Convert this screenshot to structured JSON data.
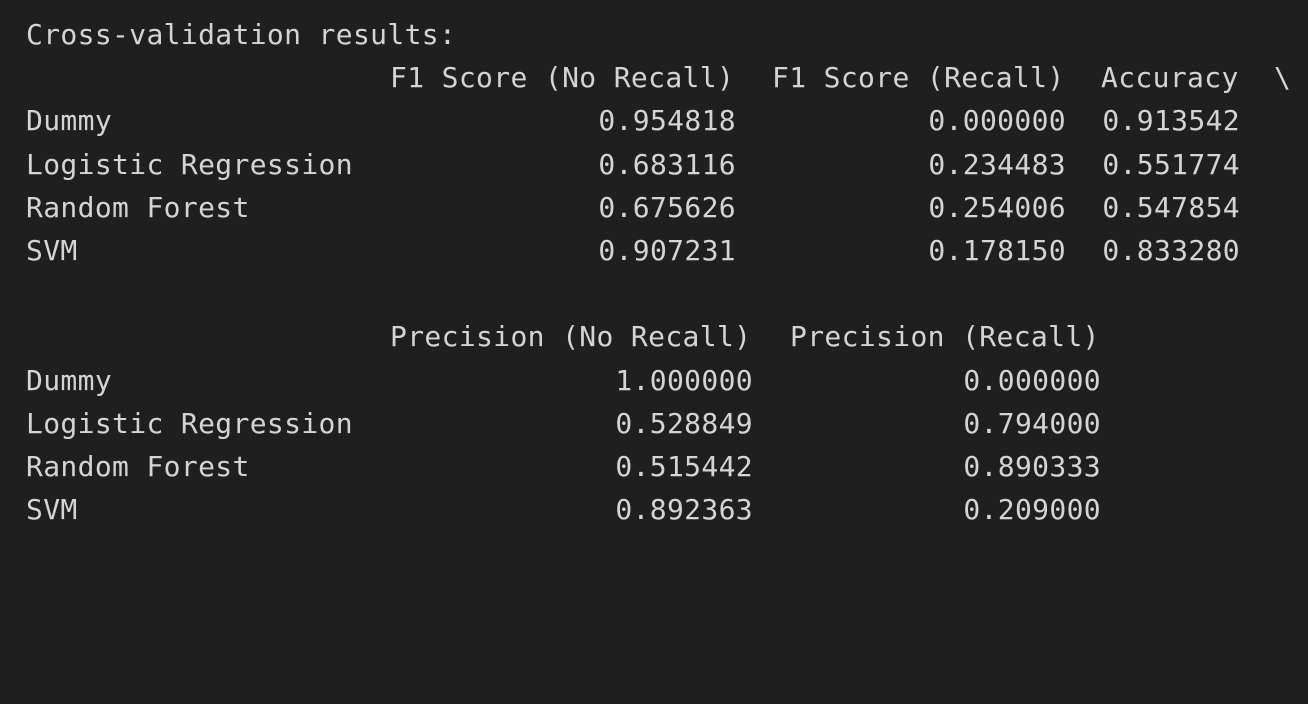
{
  "output": {
    "heading": "Cross-validation results:"
  },
  "table1": {
    "headers": [
      "F1 Score (No Recall)",
      "F1 Score (Recall)",
      "Accuracy"
    ],
    "continuation_mark": "\\",
    "rows": [
      {
        "label": "Dummy",
        "values": [
          "0.954818",
          "0.000000",
          "0.913542"
        ]
      },
      {
        "label": "Logistic Regression",
        "values": [
          "0.683116",
          "0.234483",
          "0.551774"
        ]
      },
      {
        "label": "Random Forest",
        "values": [
          "0.675626",
          "0.254006",
          "0.547854"
        ]
      },
      {
        "label": "SVM",
        "values": [
          "0.907231",
          "0.178150",
          "0.833280"
        ]
      }
    ]
  },
  "table2": {
    "headers": [
      "Precision (No Recall)",
      "Precision (Recall)"
    ],
    "rows": [
      {
        "label": "Dummy",
        "values": [
          "1.000000",
          "0.000000"
        ]
      },
      {
        "label": "Logistic Regression",
        "values": [
          "0.528849",
          "0.794000"
        ]
      },
      {
        "label": "Random Forest",
        "values": [
          "0.515442",
          "0.890333"
        ]
      },
      {
        "label": "SVM",
        "values": [
          "0.892363",
          "0.209000"
        ]
      }
    ]
  },
  "colors": {
    "background": "#1f1f1f",
    "text": "#d4d4d4"
  }
}
